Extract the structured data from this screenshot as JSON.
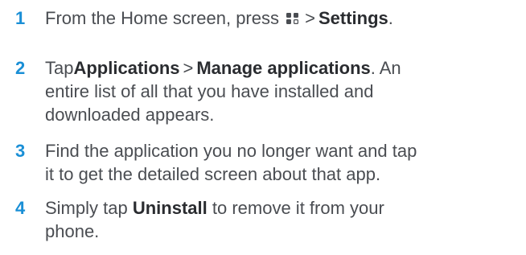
{
  "steps": [
    {
      "number": "1",
      "text_before": "From the Home screen, press",
      "icon": "menu-grid-icon",
      "separator": ">",
      "target": "Settings",
      "text_after": "."
    },
    {
      "number": "2",
      "prefix": "Tap",
      "item1": "Applications",
      "separator": ">",
      "item2": "Manage applications",
      "text_after_line1": ". An",
      "line2": "entire list of all that you have installed and",
      "line3": "downloaded appears."
    },
    {
      "number": "3",
      "line1": "Find the application you no longer want and tap",
      "line2": "it to get the detailed screen about that app."
    },
    {
      "number": "4",
      "prefix": "Simply tap",
      "action": "Uninstall",
      "text_after_line1": "to remove it from your",
      "line2": "phone."
    }
  ],
  "colors": {
    "step_number": "#1a8fd6",
    "body_text": "#4a4d52"
  }
}
